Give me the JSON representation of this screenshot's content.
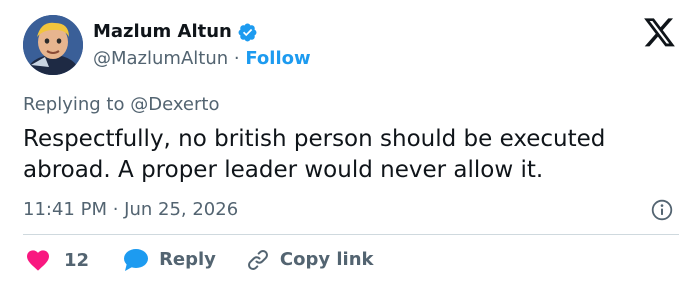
{
  "author": {
    "display_name": "Mazlum Altun",
    "handle": "@MazlumAltun",
    "separator": "·",
    "follow_label": "Follow",
    "avatar_icon": "avatar-character-icon",
    "verified_icon": "verified-badge-icon"
  },
  "brand": {
    "logo_icon": "x-logo-icon"
  },
  "tweet": {
    "replying_prefix": "Replying to",
    "replying_to": "@Dexerto",
    "text": "Respectfully, no british person should be executed\nabroad. A proper leader would never allow it.",
    "timestamp": "11:41 PM · Jun 25, 2026",
    "info_icon": "info-icon"
  },
  "actions": {
    "like_icon": "heart-icon",
    "like_count": "12",
    "reply_icon": "reply-bubble-icon",
    "reply_label": "Reply",
    "copy_icon": "link-icon",
    "copy_label": "Copy link"
  },
  "colors": {
    "accent": "#1d9bf0",
    "like": "#f91880",
    "text_primary": "#0f1419",
    "text_secondary": "#536471",
    "divider": "#cfd9de"
  }
}
